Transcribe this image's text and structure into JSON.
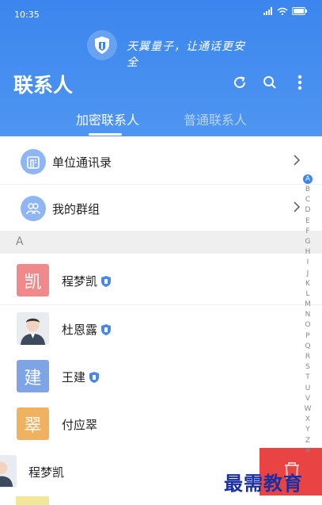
{
  "status": {
    "time": "10:35"
  },
  "header": {
    "slogan": "天翼量子，让通话更安全",
    "title": "联系人",
    "tabs": [
      {
        "label": "加密联系人",
        "active": true
      },
      {
        "label": "普通联系人",
        "active": false
      }
    ]
  },
  "menu": [
    {
      "label": "单位通讯录",
      "icon": "building-icon"
    },
    {
      "label": "我的群组",
      "icon": "group-icon"
    }
  ],
  "section": {
    "label": "A"
  },
  "contacts": [
    {
      "name": "程梦凯",
      "avatar_text": "凯",
      "avatar_color": "#f08a8a",
      "encrypted": true
    },
    {
      "name": "杜恩露",
      "avatar_text": "",
      "avatar_color": "#e8ecf1",
      "encrypted": true
    },
    {
      "name": "王建",
      "avatar_text": "建",
      "avatar_color": "#7ea4e6",
      "encrypted": true
    },
    {
      "name": "付应翠",
      "avatar_text": "翠",
      "avatar_color": "#efb260",
      "encrypted": false
    }
  ],
  "swipe_row": {
    "name": "程梦凯"
  },
  "alphabet": [
    "A",
    "B",
    "C",
    "D",
    "E",
    "F",
    "G",
    "H",
    "I",
    "J",
    "K",
    "L",
    "M",
    "N",
    "O",
    "P",
    "Q",
    "R",
    "S",
    "T",
    "U",
    "V",
    "W",
    "X",
    "Y",
    "Z",
    "#"
  ],
  "watermark": "最需教育",
  "colors": {
    "primary": "#3b86ee",
    "delete": "#e94343"
  }
}
